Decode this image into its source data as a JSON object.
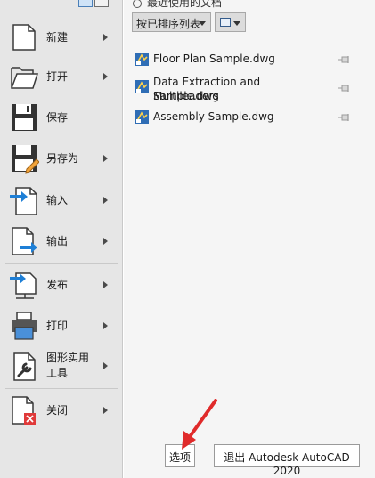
{
  "left_menu": {
    "items": [
      {
        "label": "新建",
        "has_submenu": true,
        "icon": "new-file-icon"
      },
      {
        "label": "打开",
        "has_submenu": true,
        "icon": "open-folder-icon"
      },
      {
        "label": "保存",
        "has_submenu": false,
        "icon": "save-disk-icon"
      },
      {
        "label": "另存为",
        "has_submenu": true,
        "icon": "save-as-icon"
      },
      {
        "label": "输入",
        "has_submenu": true,
        "icon": "import-icon"
      },
      {
        "label": "输出",
        "has_submenu": true,
        "icon": "export-icon"
      },
      {
        "label": "发布",
        "has_submenu": true,
        "icon": "publish-icon"
      },
      {
        "label": "打印",
        "has_submenu": true,
        "icon": "printer-icon"
      },
      {
        "label_line1": "图形实用",
        "label_line2": "工具",
        "has_submenu": true,
        "icon": "wrench-icon"
      },
      {
        "label": "关闭",
        "has_submenu": true,
        "icon": "close-file-icon"
      }
    ]
  },
  "recent": {
    "title": "最近使用的文档",
    "sort_label": "按已排序列表",
    "files": [
      {
        "line1": "Floor Plan Sample.dwg",
        "line2": ""
      },
      {
        "line1": "Data Extraction and Multileaders",
        "line2": "Sample.dwg"
      },
      {
        "line1": "Assembly Sample.dwg",
        "line2": ""
      }
    ]
  },
  "footer": {
    "options_label": "选项",
    "exit_label": "退出 Autodesk AutoCAD 2020"
  },
  "colors": {
    "menu_bg": "#e6e6e6",
    "pane_bg": "#f5f5f5",
    "accent_blue": "#1e7fd6",
    "annotation_red": "#e02a2a"
  }
}
